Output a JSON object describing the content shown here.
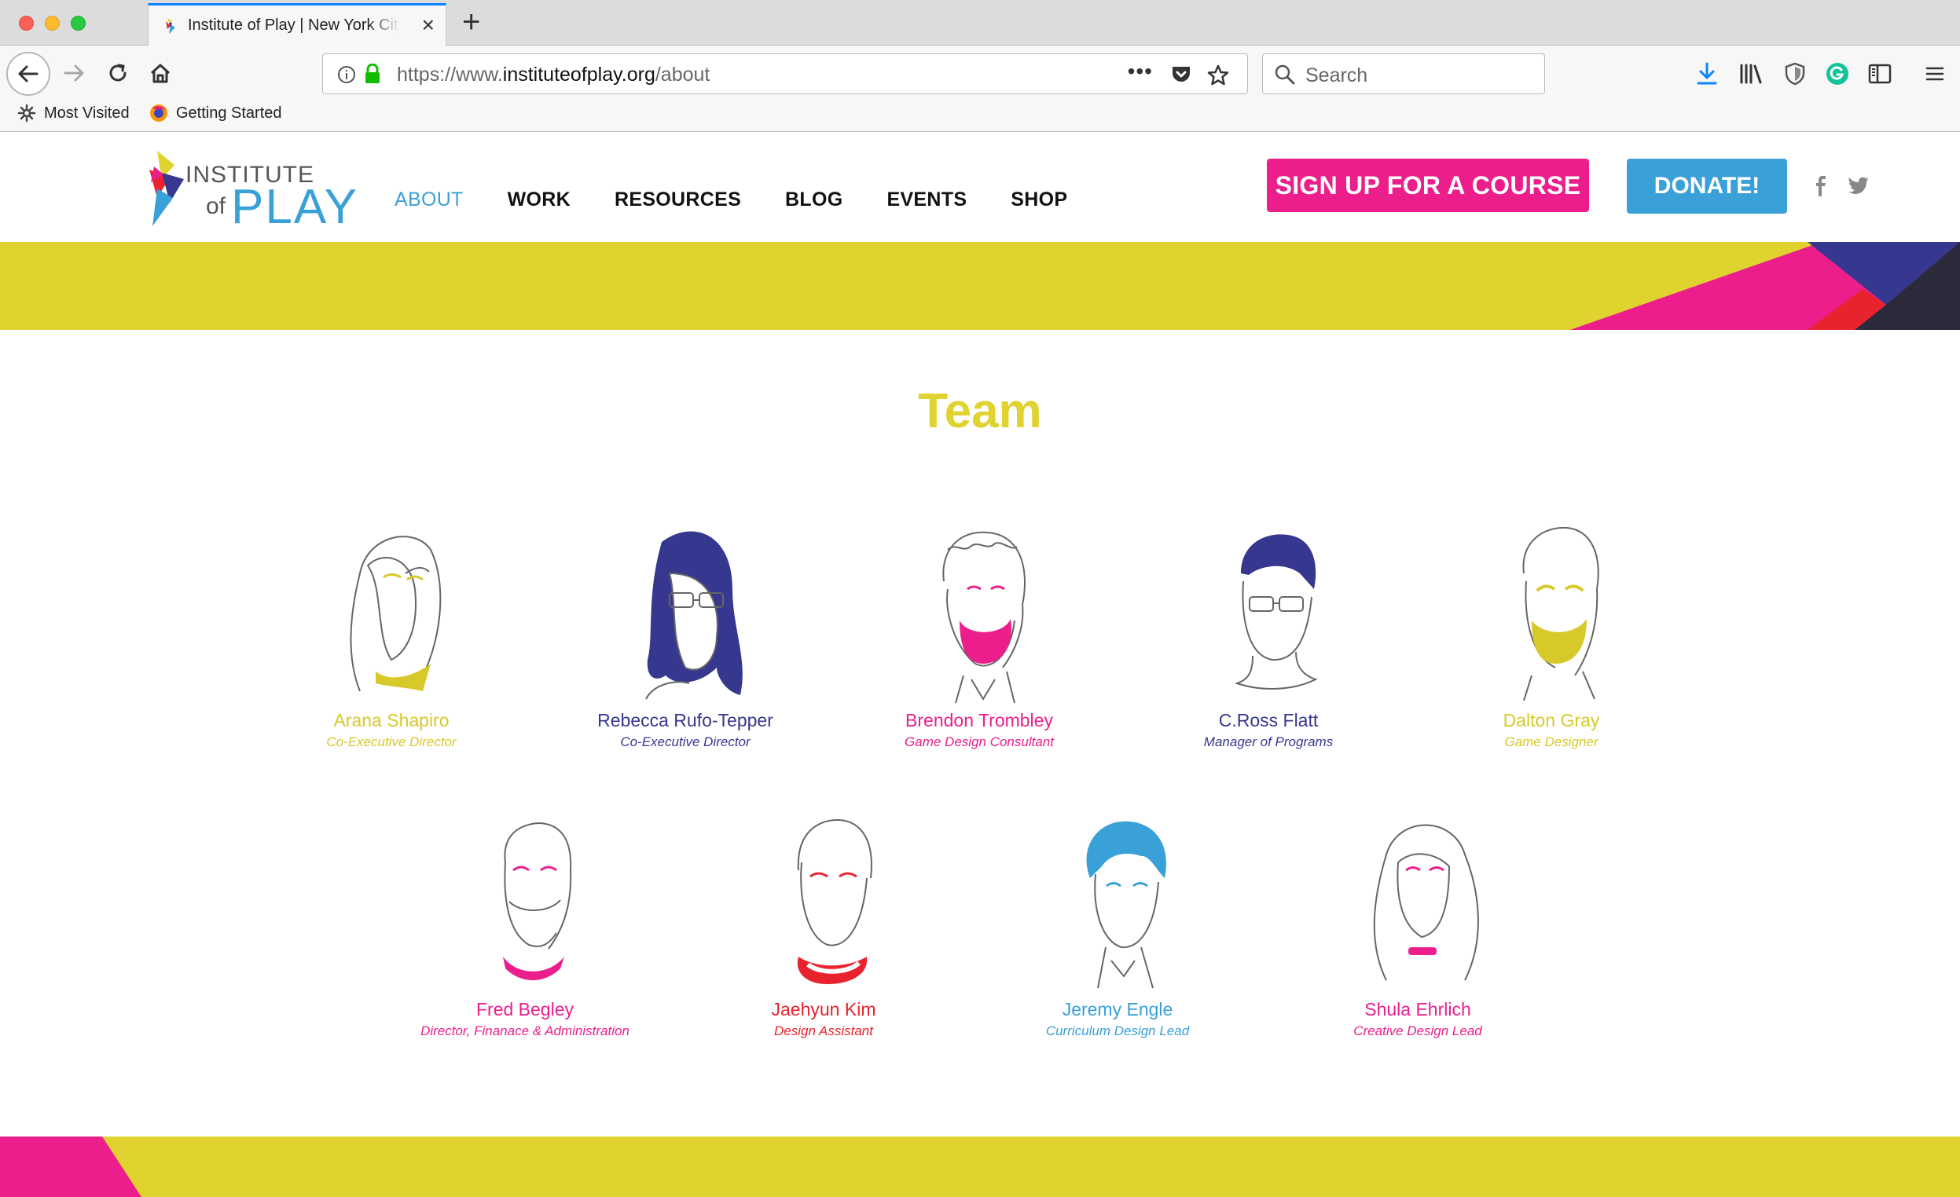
{
  "browser": {
    "tab_title": "Institute of Play | New York City",
    "url_scheme": "https://www.",
    "url_host": "instituteofplay.org",
    "url_path": "/about",
    "search_placeholder": "Search",
    "bookmarks": [
      {
        "label": "Most Visited",
        "icon": "gear-icon"
      },
      {
        "label": "Getting Started",
        "icon": "firefox-icon"
      }
    ]
  },
  "site": {
    "logo_line1": "INSTITUTE",
    "logo_line2": "of",
    "logo_line3": "PLAY",
    "nav": [
      {
        "label": "ABOUT",
        "active": true
      },
      {
        "label": "WORK",
        "active": false
      },
      {
        "label": "RESOURCES",
        "active": false
      },
      {
        "label": "BLOG",
        "active": false
      },
      {
        "label": "EVENTS",
        "active": false
      },
      {
        "label": "SHOP",
        "active": false
      }
    ],
    "cta_course": "SIGN UP FOR A COURSE",
    "cta_donate": "DONATE!",
    "colors": {
      "yellow": "#e0d22f",
      "pink": "#ec1e8c",
      "blue": "#3aa0d8",
      "navy": "#36378f",
      "red": "#e8232e"
    }
  },
  "team": {
    "title": "Team",
    "members": [
      {
        "name": "Arana Shapiro",
        "role": "Co-Executive Director",
        "color": "#d8c92a"
      },
      {
        "name": "Rebecca Rufo-Tepper",
        "role": "Co-Executive Director",
        "color": "#36378f"
      },
      {
        "name": "Brendon Trombley",
        "role": "Game Design Consultant",
        "color": "#ec1e8c"
      },
      {
        "name": "C.Ross Flatt",
        "role": "Manager of Programs",
        "color": "#36378f"
      },
      {
        "name": "Dalton Gray",
        "role": "Game Designer",
        "color": "#d8c92a"
      },
      {
        "name": "Fred Begley",
        "role": "Director, Finanace & Administration",
        "color": "#ec1e8c"
      },
      {
        "name": "Jaehyun Kim",
        "role": "Design Assistant",
        "color": "#e8232e"
      },
      {
        "name": "Jeremy Engle",
        "role": "Curriculum Design Lead",
        "color": "#3aa0d8"
      },
      {
        "name": "Shula Ehrlich",
        "role": "Creative Design Lead",
        "color": "#ec1e8c"
      }
    ]
  }
}
